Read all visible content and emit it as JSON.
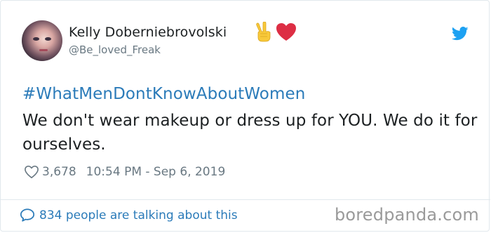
{
  "author": {
    "name": "Kelly Doberniebrovolski",
    "handle": "@Be_loved_Freak",
    "emojis": [
      "victory-hand",
      "red-heart"
    ]
  },
  "tweet": {
    "hashtag": "#WhatMenDontKnowAboutWomen",
    "text": "We don't wear makeup or dress up for YOU. We do it for ourselves.",
    "likes": "3,678",
    "timestamp": "10:54 PM - Sep 6, 2019"
  },
  "footer": {
    "talking": "834 people are talking about this"
  },
  "watermark": "boredpanda.com",
  "colors": {
    "link": "#2b7bb9",
    "muted": "#697882",
    "twitter_blue": "#1da1f2",
    "heart_red": "#e0245e"
  },
  "icons": [
    "twitter-bird-icon",
    "heart-icon",
    "speech-bubble-icon"
  ]
}
